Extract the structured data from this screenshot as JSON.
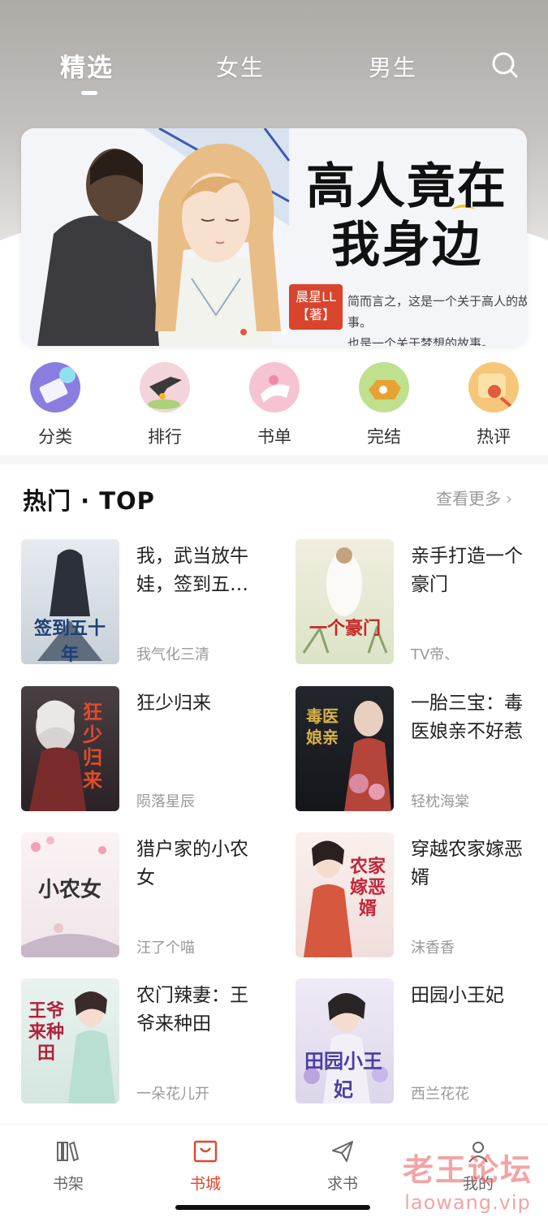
{
  "header": {
    "tabs": [
      {
        "label": "精选",
        "active": true
      },
      {
        "label": "女生",
        "active": false
      },
      {
        "label": "男生",
        "active": false
      }
    ]
  },
  "banner": {
    "title_line1": "高人竟在",
    "title_line2": "我身边",
    "author": "晨星LL",
    "author_tag": "【著】",
    "desc_line1": "简而言之，这是一个关于高人的故事。",
    "desc_line2": "也是一个关于梦想的故事。",
    "page_count": 2,
    "active_page": 1
  },
  "categories": [
    {
      "label": "分类",
      "icon": "category-icon",
      "color": "#8a7de0"
    },
    {
      "label": "排行",
      "icon": "ranking-icon",
      "color": "#f0c7d0"
    },
    {
      "label": "书单",
      "icon": "booklist-icon",
      "color": "#f6b6c8"
    },
    {
      "label": "完结",
      "icon": "finished-icon",
      "color": "#a8d46a"
    },
    {
      "label": "热评",
      "icon": "hot-comment-icon",
      "color": "#f3b04c"
    }
  ],
  "section": {
    "title": "热门 · TOP",
    "more": "查看更多"
  },
  "books": [
    {
      "title": "我，武当放牛娃，签到五十年",
      "author": "我气化三清",
      "cover_text": "签到五十年",
      "cover_bg": "#dfe4ea",
      "cover_fg": "#1d3f74"
    },
    {
      "title": "亲手打造一个豪门",
      "author": "TV帝、",
      "cover_text": "一个豪门",
      "cover_bg": "#e8ecd8",
      "cover_fg": "#c62727"
    },
    {
      "title": "狂少归来",
      "author": "陨落星辰",
      "cover_text": "狂少归来",
      "cover_bg": "#3a3034",
      "cover_fg": "#e34b2a"
    },
    {
      "title": "一胎三宝：毒医娘亲不好惹",
      "author": "轻枕海棠",
      "cover_text": "毒医娘亲",
      "cover_bg": "#1b1d22",
      "cover_fg": "#d8b24a"
    },
    {
      "title": "猎户家的小农女",
      "author": "汪了个喵",
      "cover_text": "小农女",
      "cover_bg": "#f7eef0",
      "cover_fg": "#333333"
    },
    {
      "title": "穿越农家嫁恶婿",
      "author": "沫香香",
      "cover_text": "农家嫁恶婿",
      "cover_bg": "#f6e9e6",
      "cover_fg": "#c4243a"
    },
    {
      "title": "农门辣妻：王爷来种田",
      "author": "一朵花儿开",
      "cover_text": "王爷来种田",
      "cover_bg": "#dfeee9",
      "cover_fg": "#b3213a"
    },
    {
      "title": "田园小王妃",
      "author": "西兰花花",
      "cover_text": "田园小王妃",
      "cover_bg": "#ece6f3",
      "cover_fg": "#4a3fa0"
    }
  ],
  "bottom_nav": [
    {
      "label": "书架",
      "icon": "bookshelf-icon",
      "active": false
    },
    {
      "label": "书城",
      "icon": "bookstore-icon",
      "active": true
    },
    {
      "label": "求书",
      "icon": "paper-plane-icon",
      "active": false
    },
    {
      "label": "我的",
      "icon": "profile-icon",
      "active": false
    }
  ],
  "watermark": {
    "line1": "老王论坛",
    "line2": "laowang.vip"
  },
  "colors": {
    "accent": "#e2452b",
    "muted": "#999999"
  }
}
